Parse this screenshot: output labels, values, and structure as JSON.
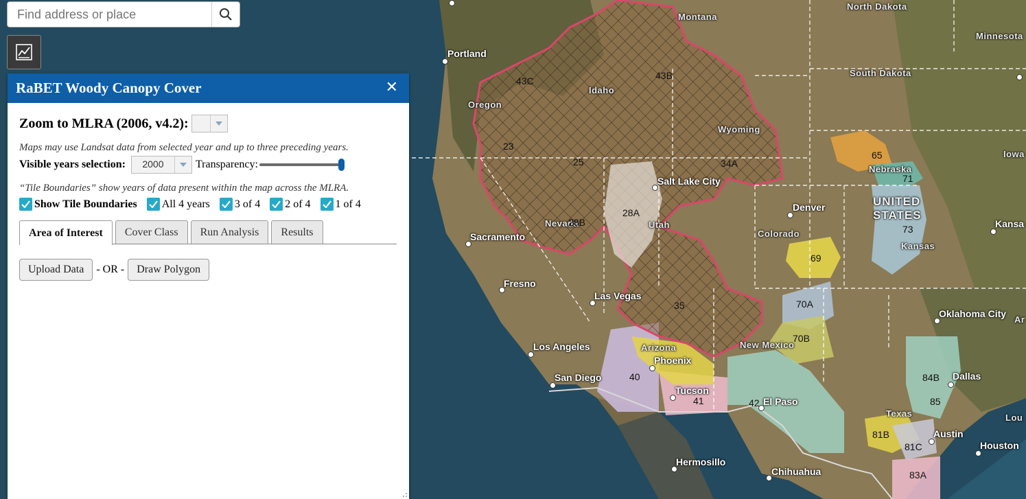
{
  "search": {
    "placeholder": "Find address or place"
  },
  "panel": {
    "title": "RaBET Woody Canopy Cover",
    "zoom_label": "Zoom to MLRA (2006, v4.2):",
    "zoom_value": "",
    "note1": "Maps may use Landsat data from selected year and up to three preceding years.",
    "years_label": "Visible years selection:",
    "year_value": "2000",
    "transparency_label": "Transparency:",
    "transparency": 1.0,
    "note2": "“Tile Boundaries” show years of data present within the map across the MLRA.",
    "checkboxes": [
      {
        "label": "Show Tile Boundaries",
        "checked": true
      },
      {
        "label": "All 4 years",
        "checked": true
      },
      {
        "label": "3 of 4",
        "checked": true
      },
      {
        "label": "2 of 4",
        "checked": true
      },
      {
        "label": "1 of 4",
        "checked": true
      }
    ],
    "tabs": [
      "Area of Interest",
      "Cover Class",
      "Run Analysis",
      "Results"
    ],
    "active_tab": "Area of Interest",
    "upload_label": "Upload Data",
    "or_label": "- OR -",
    "draw_label": "Draw Polygon"
  },
  "map": {
    "cities": [
      "Portland",
      "Salt Lake City",
      "Denver",
      "Sacramento",
      "Fresno",
      "Las Vegas",
      "Los Angeles",
      "San Diego",
      "Phoenix",
      "Tucson",
      "El Paso",
      "Hermosillo",
      "Chihuahua",
      "Oklahoma City",
      "Dallas",
      "Austin",
      "Houston",
      "Kansa"
    ],
    "states": [
      "North Dakota",
      "Montana",
      "Minnesota",
      "South Dakota",
      "Idaho",
      "Oregon",
      "Wyoming",
      "Iowa",
      "Nebraska",
      "Nevada",
      "Utah",
      "Colorado",
      "Kansas",
      "Arizona",
      "New Mexico",
      "Texas",
      "Lou",
      "Ar"
    ],
    "country": [
      "UNITED",
      "STATES"
    ],
    "mlra_codes": [
      "43C",
      "43B",
      "23",
      "25",
      "34A",
      "28A",
      "28B",
      "65",
      "71",
      "73",
      "69",
      "35",
      "70A",
      "70B",
      "40",
      "41",
      "42",
      "84B",
      "85",
      "81B",
      "81C",
      "83A"
    ],
    "colors": {
      "water": "#234a5e",
      "land": "#8a7a55",
      "mlra_outline": "#d9476a",
      "mlra_orange": "#e0a040",
      "mlra_teal": "#6fb7a8",
      "mlra_yellow": "#e3d44a"
    }
  }
}
